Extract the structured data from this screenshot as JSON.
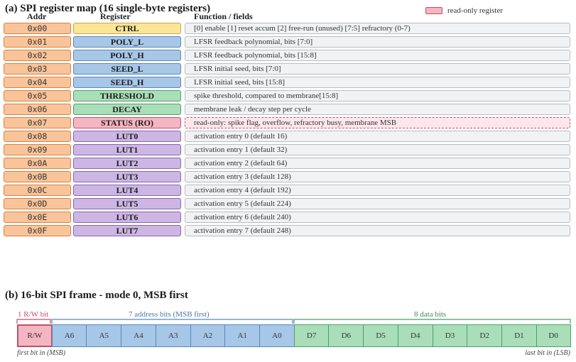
{
  "section_a": {
    "title": "(a)  SPI register map (16 single-byte registers)",
    "legend_label": "read-only register",
    "col_addr": "Addr",
    "col_register": "Register",
    "col_function": "Function / fields"
  },
  "registers": [
    {
      "addr": "0x00",
      "name": "CTRL",
      "desc": "[0] enable   [1] reset accum   [2] free-run (unused)   [7:5] refractory (0-7)",
      "kind": "ctrl"
    },
    {
      "addr": "0x01",
      "name": "POLY_L",
      "desc": "LFSR feedback polynomial, bits [7:0]",
      "kind": "poly"
    },
    {
      "addr": "0x02",
      "name": "POLY_H",
      "desc": "LFSR feedback polynomial, bits [15:8]",
      "kind": "poly"
    },
    {
      "addr": "0x03",
      "name": "SEED_L",
      "desc": "LFSR initial seed, bits [7:0]",
      "kind": "seed"
    },
    {
      "addr": "0x04",
      "name": "SEED_H",
      "desc": "LFSR initial seed, bits [15:8]",
      "kind": "seed"
    },
    {
      "addr": "0x05",
      "name": "THRESHOLD",
      "desc": "spike threshold, compared to membrane[15:8]",
      "kind": "thresh"
    },
    {
      "addr": "0x06",
      "name": "DECAY",
      "desc": "membrane leak / decay step per cycle",
      "kind": "decay"
    },
    {
      "addr": "0x07",
      "name": "STATUS  (RO)",
      "desc": "read-only: spike flag, overflow, refractory busy, membrane MSB",
      "kind": "status"
    },
    {
      "addr": "0x08",
      "name": "LUT0",
      "desc": "activation entry 0   (default 16)",
      "kind": "lut"
    },
    {
      "addr": "0x09",
      "name": "LUT1",
      "desc": "activation entry 1   (default 32)",
      "kind": "lut"
    },
    {
      "addr": "0x0A",
      "name": "LUT2",
      "desc": "activation entry 2   (default 64)",
      "kind": "lut"
    },
    {
      "addr": "0x0B",
      "name": "LUT3",
      "desc": "activation entry 3   (default 128)",
      "kind": "lut"
    },
    {
      "addr": "0x0C",
      "name": "LUT4",
      "desc": "activation entry 4   (default 192)",
      "kind": "lut"
    },
    {
      "addr": "0x0D",
      "name": "LUT5",
      "desc": "activation entry 5   (default 224)",
      "kind": "lut"
    },
    {
      "addr": "0x0E",
      "name": "LUT6",
      "desc": "activation entry 6   (default 240)",
      "kind": "lut"
    },
    {
      "addr": "0x0F",
      "name": "LUT7",
      "desc": "activation entry 7   (default 248)",
      "kind": "lut"
    }
  ],
  "section_b": {
    "title": "(b)  16-bit SPI frame  -  mode 0, MSB first",
    "rw_label": "1 R/W bit",
    "addr_label": "7 address bits (MSB first)",
    "data_label": "8 data bits",
    "first_note": "first bit in (MSB)",
    "last_note": "last bit in (LSB)",
    "bits": [
      "R/W",
      "A6",
      "A5",
      "A4",
      "A3",
      "A2",
      "A1",
      "A0",
      "D7",
      "D6",
      "D5",
      "D4",
      "D3",
      "D2",
      "D1",
      "D0"
    ],
    "colors": {
      "rw": "#c0506a",
      "addr": "#5b86b8",
      "data": "#4f9e68"
    }
  }
}
